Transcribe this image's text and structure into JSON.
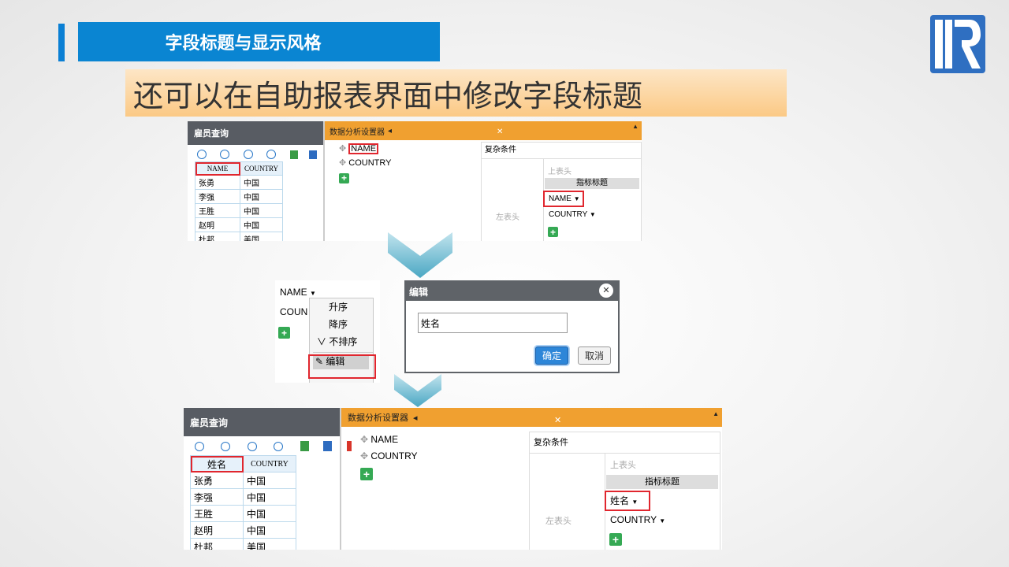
{
  "header": {
    "section_title": "字段标题与显示风格",
    "headline": "还可以在自助报表界面中修改字段标题"
  },
  "colors": {
    "accent_blue": "#0a85d2",
    "accent_orange": "#f0a030",
    "highlight_red": "#e0262e",
    "plus_green": "#35a954"
  },
  "logo": {
    "icon": "r-logo-icon"
  },
  "shot1": {
    "sidebar_title": "雇员查询",
    "table_headers": [
      "NAME",
      "COUNTRY"
    ],
    "rows": [
      [
        "张勇",
        "中国"
      ],
      [
        "李强",
        "中国"
      ],
      [
        "王胜",
        "中国"
      ],
      [
        "赵明",
        "中国"
      ],
      [
        "杜邦",
        "美国"
      ]
    ],
    "analysis_title": "数据分析设置器",
    "fields": [
      "NAME",
      "COUNTRY"
    ],
    "complex_condition": "复杂条件",
    "top_header": "上表头",
    "index_title": "指标标题",
    "left_header": "左表头",
    "measures": [
      "NAME",
      "COUNTRY"
    ]
  },
  "menu": {
    "field_label": "NAME",
    "field2_partial": "COUN",
    "items": [
      "升序",
      "降序",
      "不排序",
      "编辑"
    ]
  },
  "edit_dialog": {
    "title": "编辑",
    "input_value": "姓名",
    "ok": "确定",
    "cancel": "取消"
  },
  "shot2": {
    "sidebar_title": "雇员查询",
    "table_headers": [
      "姓名",
      "COUNTRY"
    ],
    "rows": [
      [
        "张勇",
        "中国"
      ],
      [
        "李强",
        "中国"
      ],
      [
        "王胜",
        "中国"
      ],
      [
        "赵明",
        "中国"
      ],
      [
        "杜邦",
        "美国"
      ]
    ],
    "analysis_title": "数据分析设置器",
    "fields": [
      "NAME",
      "COUNTRY"
    ],
    "complex_condition": "复杂条件",
    "top_header": "上表头",
    "index_title": "指标标题",
    "left_header": "左表头",
    "measures": [
      "姓名",
      "COUNTRY"
    ]
  }
}
